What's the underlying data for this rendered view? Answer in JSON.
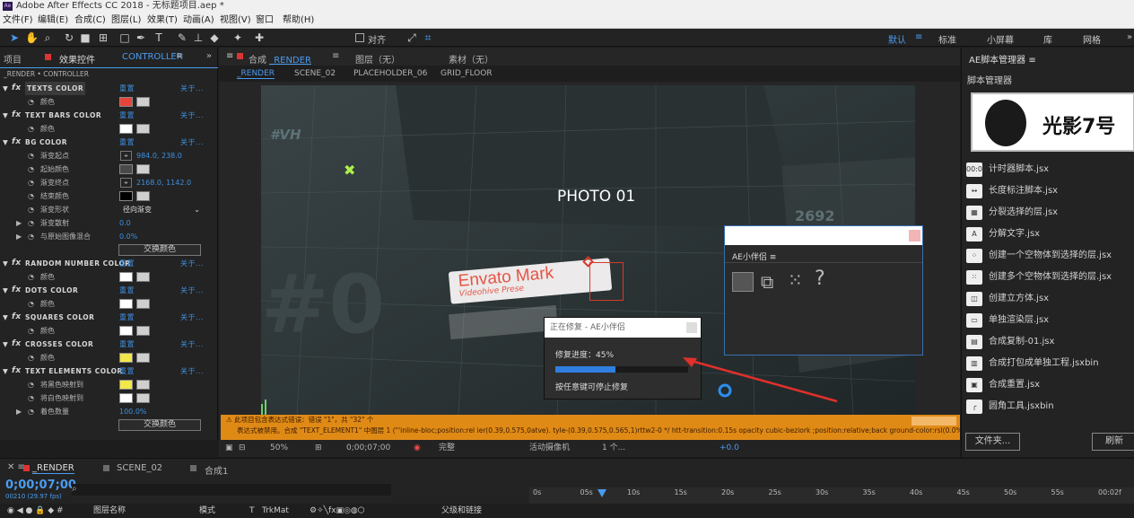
{
  "app": {
    "title": "Adobe After Effects CC 2018 - 无标题项目.aep *",
    "logo_text": "Ae"
  },
  "menu": [
    "文件(F)",
    "编辑(E)",
    "合成(C)",
    "图层(L)",
    "效果(T)",
    "动画(A)",
    "视图(V)",
    "窗口",
    "帮助(H)"
  ],
  "toolbar": {
    "snap_label": "对齐",
    "workspaces": [
      "默认",
      "标准",
      "小屏幕",
      "库",
      "网格"
    ],
    "active_workspace": "默认"
  },
  "left_panel": {
    "tab_project": "项目",
    "tab_effects": "效果控件",
    "tab_effects_target": "CONTROLLER",
    "breadcrumb": "_RENDER • CONTROLLER",
    "reset": "重置",
    "about": "关于...",
    "rows": [
      {
        "type": "fx",
        "label": "TEXTS COLOR"
      },
      {
        "type": "prop",
        "label": "颜色",
        "swatch": "#e8433a"
      },
      {
        "type": "fx",
        "label": "TEXT BARS COLOR"
      },
      {
        "type": "prop",
        "label": "颜色",
        "swatch": "#ffffff"
      },
      {
        "type": "fx",
        "label": "BG COLOR"
      },
      {
        "type": "prop",
        "label": "渐变起点",
        "value": "984.0, 238.0"
      },
      {
        "type": "prop",
        "label": "起始颜色",
        "swatch": "#4a4a4a"
      },
      {
        "type": "prop",
        "label": "渐变终点",
        "value": "2168.0, 1142.0"
      },
      {
        "type": "prop",
        "label": "结束颜色",
        "swatch": "#000000"
      },
      {
        "type": "prop",
        "label": "渐变形状",
        "dropdown": "径向渐变"
      },
      {
        "type": "prop",
        "label": "渐变散射",
        "value": "0.0",
        "expand": true
      },
      {
        "type": "prop",
        "label": "与原始图像混合",
        "value": "0.0%",
        "expand": true
      },
      {
        "type": "button",
        "label": "交换颜色"
      },
      {
        "type": "fx",
        "label": "RANDOM NUMBER COLOR"
      },
      {
        "type": "prop",
        "label": "颜色",
        "swatch": "#ffffff"
      },
      {
        "type": "fx",
        "label": "DOTS COLOR"
      },
      {
        "type": "prop",
        "label": "颜色",
        "swatch": "#ffffff"
      },
      {
        "type": "fx",
        "label": "SQUARES COLOR"
      },
      {
        "type": "prop",
        "label": "颜色",
        "swatch": "#ffffff"
      },
      {
        "type": "fx",
        "label": "CROSSES COLOR"
      },
      {
        "type": "prop",
        "label": "颜色",
        "swatch": "#f2e84a"
      },
      {
        "type": "fx",
        "label": "TEXT ELEMENTS COLOR"
      },
      {
        "type": "prop",
        "label": "将黑色映射到",
        "swatch": "#f2e84a"
      },
      {
        "type": "prop",
        "label": "将白色映射到",
        "swatch": "#ffffff"
      },
      {
        "type": "prop",
        "label": "着色数量",
        "value": "100.0%",
        "expand": true
      },
      {
        "type": "button",
        "label": "交换颜色"
      }
    ]
  },
  "viewer": {
    "tab_label": "合成",
    "tab_comp": "_RENDER",
    "tab_layer": "图层（无）",
    "tab_footage": "素材（无）",
    "breadcrumbs": [
      "_RENDER",
      "SCENE_02",
      "PLACEHOLDER_06",
      "GRID_FLOOR"
    ],
    "comp": {
      "hashtag": "#VH",
      "photo": "PHOTO 01",
      "number": "2692",
      "big": "#0",
      "mark_title": "Envato Mark",
      "mark_sub": "Videohive Prese"
    },
    "error_text": "此项目包含表达式错误：错误 \"1\"，共 \"32\" 个",
    "error_detail": "表达式被禁用。合成 \"TEXT_ELEMENT1\" 中图层 1 (\"'inline-bloc;position:rel ier(0.39,0.575,0atve). tyle-(0.39,0.575,0.565,1)rttw2-0 */ htt-transition:0.15s opacity cubic-beziork ;position:relative;back ground-color:rsl(0.0%.2 st3px;).lDex",
    "bottom": {
      "zoom": "50%",
      "timecode": "0;00;07;00",
      "quality": "完整",
      "camera": "活动摄像机",
      "views": "1 个...",
      "exposure": "+0.0"
    }
  },
  "repair_dialog": {
    "title": "正在修复 - AE小伴侣",
    "progress_label": "修复进度：45%",
    "progress": 0.45,
    "hint": "按任意键可停止修复"
  },
  "ae_helper": {
    "title": "AE小伴侣"
  },
  "right_panel": {
    "tab": "AE脚本管理器",
    "subtitle": "脚本管理器",
    "banner": "光影7号",
    "scripts": [
      {
        "icon": "timer-icon",
        "glyph": "00:00",
        "name": "计时器脚本.jsx"
      },
      {
        "icon": "ruler-icon",
        "glyph": "↔",
        "name": "长度标注脚本.jsx"
      },
      {
        "icon": "split-icon",
        "glyph": "▦",
        "name": "分裂选择的层.jsx"
      },
      {
        "icon": "text-split-icon",
        "glyph": "A",
        "name": "分解文字.jsx"
      },
      {
        "icon": "null-icon",
        "glyph": "⁘",
        "name": "创建一个空物体到选择的层.jsx"
      },
      {
        "icon": "nulls-icon",
        "glyph": "⁙",
        "name": "创建多个空物体到选择的层.jsx"
      },
      {
        "icon": "cube-icon",
        "glyph": "◫",
        "name": "创建立方体.jsx"
      },
      {
        "icon": "render-icon",
        "glyph": "▭",
        "name": "单独渲染层.jsx"
      },
      {
        "icon": "copy-comp-icon",
        "glyph": "▤",
        "name": "合成复制-01.jsx"
      },
      {
        "icon": "package-icon",
        "glyph": "▥",
        "name": "合成打包成单独工程.jsxbin"
      },
      {
        "icon": "reset-icon",
        "glyph": "▣",
        "name": "合成重置.jsx"
      },
      {
        "icon": "round-corner-icon",
        "glyph": "╭",
        "name": "圆角工具.jsxbin"
      }
    ],
    "folder_btn": "文件夹...",
    "refresh_btn": "刷新"
  },
  "timeline": {
    "tabs": [
      "_RENDER",
      "SCENE_02",
      "合成1"
    ],
    "timecode": "0;00;07;00",
    "fps": "00210 (29.97 fps)",
    "columns": {
      "layer_name": "图层名称",
      "mode": "模式",
      "t": "T",
      "trkmat": "TrkMat",
      "parent": "父级和链接"
    },
    "ruler": [
      "0s",
      "05s",
      "10s",
      "15s",
      "20s",
      "25s",
      "30s",
      "35s",
      "40s",
      "45s",
      "50s",
      "55s",
      "00:02f"
    ]
  }
}
